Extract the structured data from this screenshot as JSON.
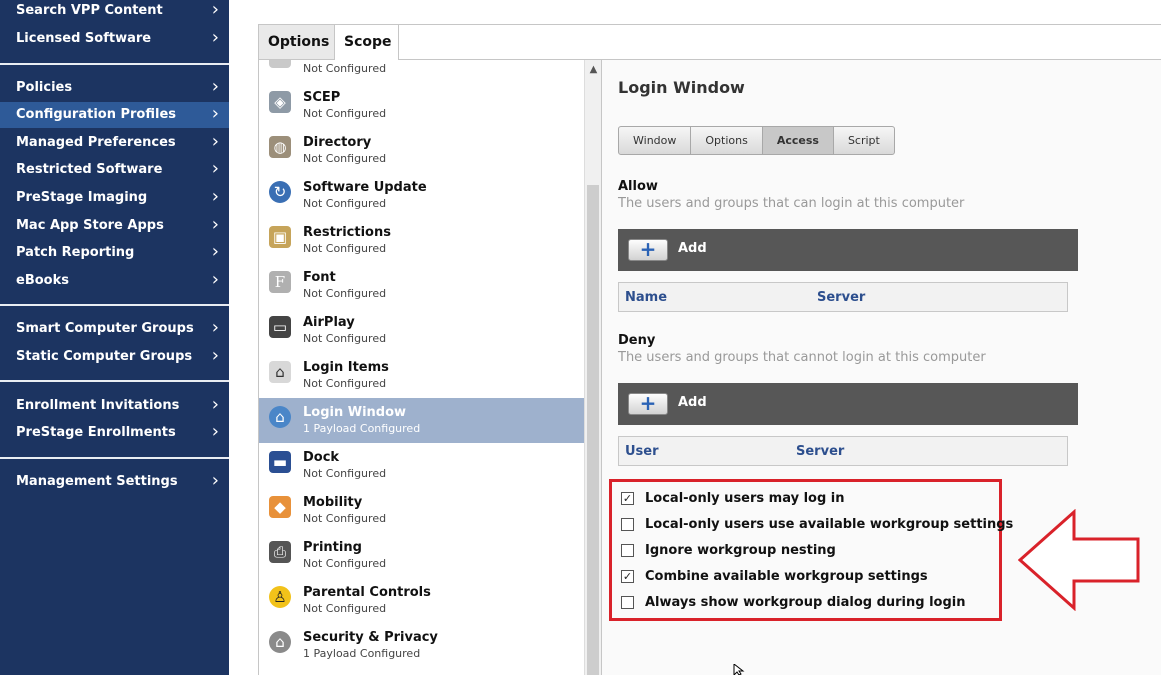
{
  "sidebar": {
    "items": [
      {
        "label": "Search VPP Content"
      },
      {
        "label": "Licensed Software"
      },
      {
        "label": "Policies"
      },
      {
        "label": "Configuration Profiles"
      },
      {
        "label": "Managed Preferences"
      },
      {
        "label": "Restricted Software"
      },
      {
        "label": "PreStage Imaging"
      },
      {
        "label": "Mac App Store Apps"
      },
      {
        "label": "Patch Reporting"
      },
      {
        "label": "eBooks"
      },
      {
        "label": "Smart Computer Groups"
      },
      {
        "label": "Static Computer Groups"
      },
      {
        "label": "Enrollment Invitations"
      },
      {
        "label": "PreStage Enrollments"
      },
      {
        "label": "Management Settings"
      }
    ],
    "chevron": "›",
    "active_color": "#2e5a98",
    "background_color": "#1c3461"
  },
  "tabs": {
    "options_label": "Options",
    "scope_label": "Scope"
  },
  "payloads": {
    "items": [
      {
        "name": "",
        "status": "Not Configured",
        "icon": "generic-icon"
      },
      {
        "name": "SCEP",
        "status": "Not Configured",
        "icon": "lock-certificate-icon"
      },
      {
        "name": "Directory",
        "status": "Not Configured",
        "icon": "directory-icon"
      },
      {
        "name": "Software Update",
        "status": "Not Configured",
        "icon": "software-update-icon"
      },
      {
        "name": "Restrictions",
        "status": "Not Configured",
        "icon": "padlock-icon"
      },
      {
        "name": "Font",
        "status": "Not Configured",
        "icon": "font-icon"
      },
      {
        "name": "AirPlay",
        "status": "Not Configured",
        "icon": "airplay-icon"
      },
      {
        "name": "Login Items",
        "status": "Not Configured",
        "icon": "login-items-icon"
      },
      {
        "name": "Login Window",
        "status": "1 Payload Configured",
        "icon": "login-window-icon"
      },
      {
        "name": "Dock",
        "status": "Not Configured",
        "icon": "dock-icon"
      },
      {
        "name": "Mobility",
        "status": "Not Configured",
        "icon": "mobility-icon"
      },
      {
        "name": "Printing",
        "status": "Not Configured",
        "icon": "printer-icon"
      },
      {
        "name": "Parental Controls",
        "status": "Not Configured",
        "icon": "parental-controls-icon"
      },
      {
        "name": "Security & Privacy",
        "status": "1 Payload Configured",
        "icon": "security-privacy-icon"
      }
    ]
  },
  "panel": {
    "title": "Login Window",
    "subtabs": [
      {
        "label": "Window"
      },
      {
        "label": "Options"
      },
      {
        "label": "Access"
      },
      {
        "label": "Script"
      }
    ],
    "active_subtab": "Access",
    "allow": {
      "label": "Allow",
      "description": "The users and groups that can login at this computer",
      "add_label": "Add",
      "col1": "Name",
      "col2": "Server"
    },
    "deny": {
      "label": "Deny",
      "description": "The users and groups that cannot login at this computer",
      "add_label": "Add",
      "col1": "User",
      "col2": "Server"
    },
    "add_symbol": "+",
    "checkboxes": [
      {
        "label": "Local-only users may log in",
        "checked": true
      },
      {
        "label": "Local-only users use available workgroup settings",
        "checked": false
      },
      {
        "label": "Ignore workgroup nesting",
        "checked": false
      },
      {
        "label": "Combine available workgroup settings",
        "checked": true
      },
      {
        "label": "Always show workgroup dialog during login",
        "checked": false
      }
    ],
    "check_mark": "✓",
    "highlight_color": "#d9222a"
  }
}
